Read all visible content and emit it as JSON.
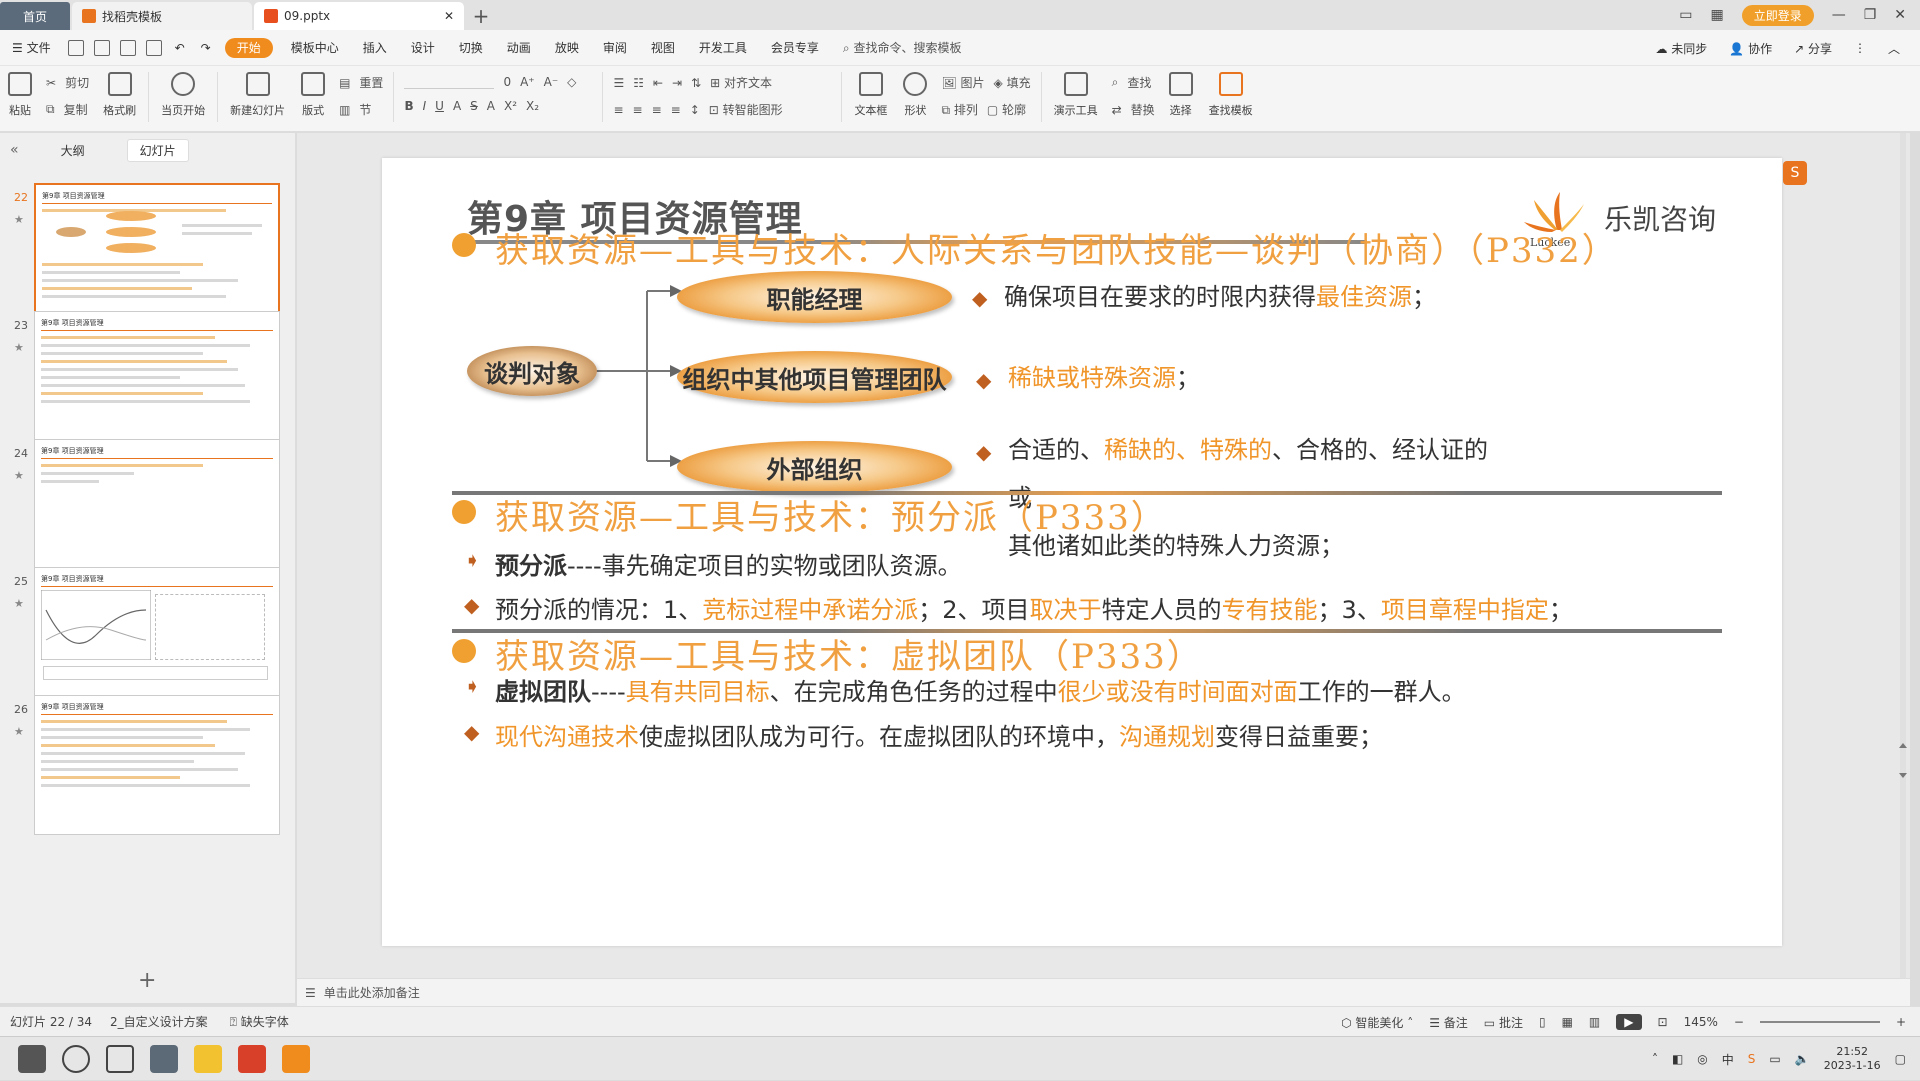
{
  "tabs": [
    {
      "label": "首页"
    },
    {
      "label": "找稻壳模板"
    },
    {
      "label": "09.pptx"
    }
  ],
  "window": {
    "login": "立即登录"
  },
  "menu": {
    "file": "文件",
    "items": [
      "开始",
      "模板中心",
      "插入",
      "设计",
      "切换",
      "动画",
      "放映",
      "审阅",
      "视图",
      "开发工具",
      "会员专享"
    ],
    "search": "查找命令、搜索模板",
    "sync": "未同步",
    "collab": "协作",
    "share": "分享"
  },
  "toolbar": {
    "paste": "粘贴",
    "cut": "剪切",
    "copy": "复制",
    "format": "格式刷",
    "play": "当页开始",
    "newslide": "新建幻灯片",
    "layout": "版式",
    "section": "节",
    "reset": "重置",
    "font_size": "0",
    "align_text": "对齐文本",
    "smart": "转智能图形",
    "textbox": "文本框",
    "shape": "形状",
    "image": "图片",
    "fill": "填充",
    "arrange": "排列",
    "outline": "轮廓",
    "present": "演示工具",
    "find": "查找",
    "replace": "替换",
    "select": "选择",
    "find_tpl": "查找模板"
  },
  "panel": {
    "outline": "大纲",
    "slides": "幻灯片",
    "thumb_title": "第9章 项目资源管理",
    "nums": [
      "22",
      "23",
      "24",
      "25",
      "26"
    ]
  },
  "slide": {
    "title": "第9章 项目资源管理",
    "logo_text": "乐凯咨询",
    "logo_sub": "Luckee",
    "h1": "获取资源—工具与技术：人际关系与团队技能—谈判（协商）（P332）",
    "center": "谈判对象",
    "n1": "职能经理",
    "n2": "组织中其他项目管理团队",
    "n3": "外部组织",
    "d1a": "确保项目在要求的时限内获得",
    "d1b": "最佳资源",
    "d1c": "；",
    "d2a": "稀缺或特殊资源",
    "d2b": "；",
    "d3a": "合适的、",
    "d3b": "稀缺的、特殊的",
    "d3c": "、合格的、经认证的或",
    "d3d": "其他诸如此类的特殊人力资源；",
    "h2": "获取资源—工具与技术：预分派（P333）",
    "p1a": "预分派",
    "p1b": "----事先确定项目的实物或团队资源。",
    "p2a": "预分派的情况：1、",
    "p2b": "竞标过程中承诺分派",
    "p2c": "；2、项目",
    "p2d": "取决于",
    "p2e": "特定人员的",
    "p2f": "专有技能",
    "p2g": "；3、",
    "p2h": "项目章程中指定",
    "p2i": "；",
    "h3": "获取资源—工具与技术：虚拟团队（P333）",
    "p3a": "虚拟团队",
    "p3b": "----",
    "p3c": "具有共同目标",
    "p3d": "、在完成角色任务的过程中",
    "p3e": "很少或没有时间面对面",
    "p3f": "工作的一群人。",
    "p4a": "现代沟通技术",
    "p4b": "使虚拟团队成为可行。在虚拟团队的环境中，",
    "p4c": "沟通规划",
    "p4d": "变得日益重要；"
  },
  "notes": "单击此处添加备注",
  "status": {
    "slide": "幻灯片 22 / 34",
    "theme": "2_自定义设计方案",
    "font": "缺失字体",
    "beautify": "智能美化",
    "notes": "备注",
    "comment": "批注",
    "zoom": "145%"
  },
  "taskbar": {
    "time": "21:52",
    "date": "2023-1-16",
    "ime": "中"
  },
  "colors": {
    "accent": "#F08C1E",
    "orange_text": "#F0952A"
  }
}
